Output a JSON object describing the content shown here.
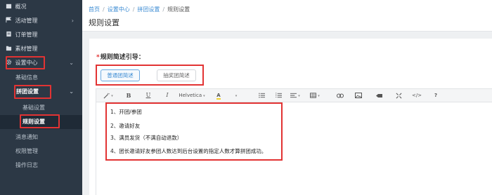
{
  "sidebar": {
    "items": [
      {
        "label": "概况",
        "icon": "home-icon"
      },
      {
        "label": "活动管理",
        "icon": "flag-icon",
        "chevron": "›"
      },
      {
        "label": "订单管理",
        "icon": "document-icon"
      },
      {
        "label": "素材管理",
        "icon": "folder-icon"
      },
      {
        "label": "设置中心",
        "icon": "gear-icon",
        "chevron": "⌄"
      },
      {
        "label": "基础信息"
      },
      {
        "label": "拼团设置",
        "chevron": "⌄"
      },
      {
        "label": "基础设置"
      },
      {
        "label": "规则设置"
      },
      {
        "label": "消息通知"
      },
      {
        "label": "权限管理"
      },
      {
        "label": "操作日志"
      }
    ]
  },
  "header": {
    "breadcrumb": [
      "首页",
      "设置中心",
      "拼团设置",
      "规则设置"
    ],
    "separator": "/",
    "title": "规则设置"
  },
  "form": {
    "required_mark": "*",
    "label": "规则简述引导：",
    "tabs": [
      "普通团简述",
      "抽奖团简述"
    ]
  },
  "toolbar": {
    "bold": "B",
    "italic": "I",
    "underline": "U",
    "font": "Helvetica",
    "font_color": "A",
    "caret": "▾",
    "code": "</>",
    "help": "?"
  },
  "editor": {
    "lines": [
      "1、开团/参团",
      "2、邀请好友",
      "3、满员发货（不满自动退款）",
      "4、团长邀请好友参团人数达到后台设置的指定人数才算拼团成功。"
    ]
  },
  "colors": {
    "sidebar_bg": "#2c3845",
    "accent": "#3b8bd3",
    "highlight": "#e23333"
  }
}
